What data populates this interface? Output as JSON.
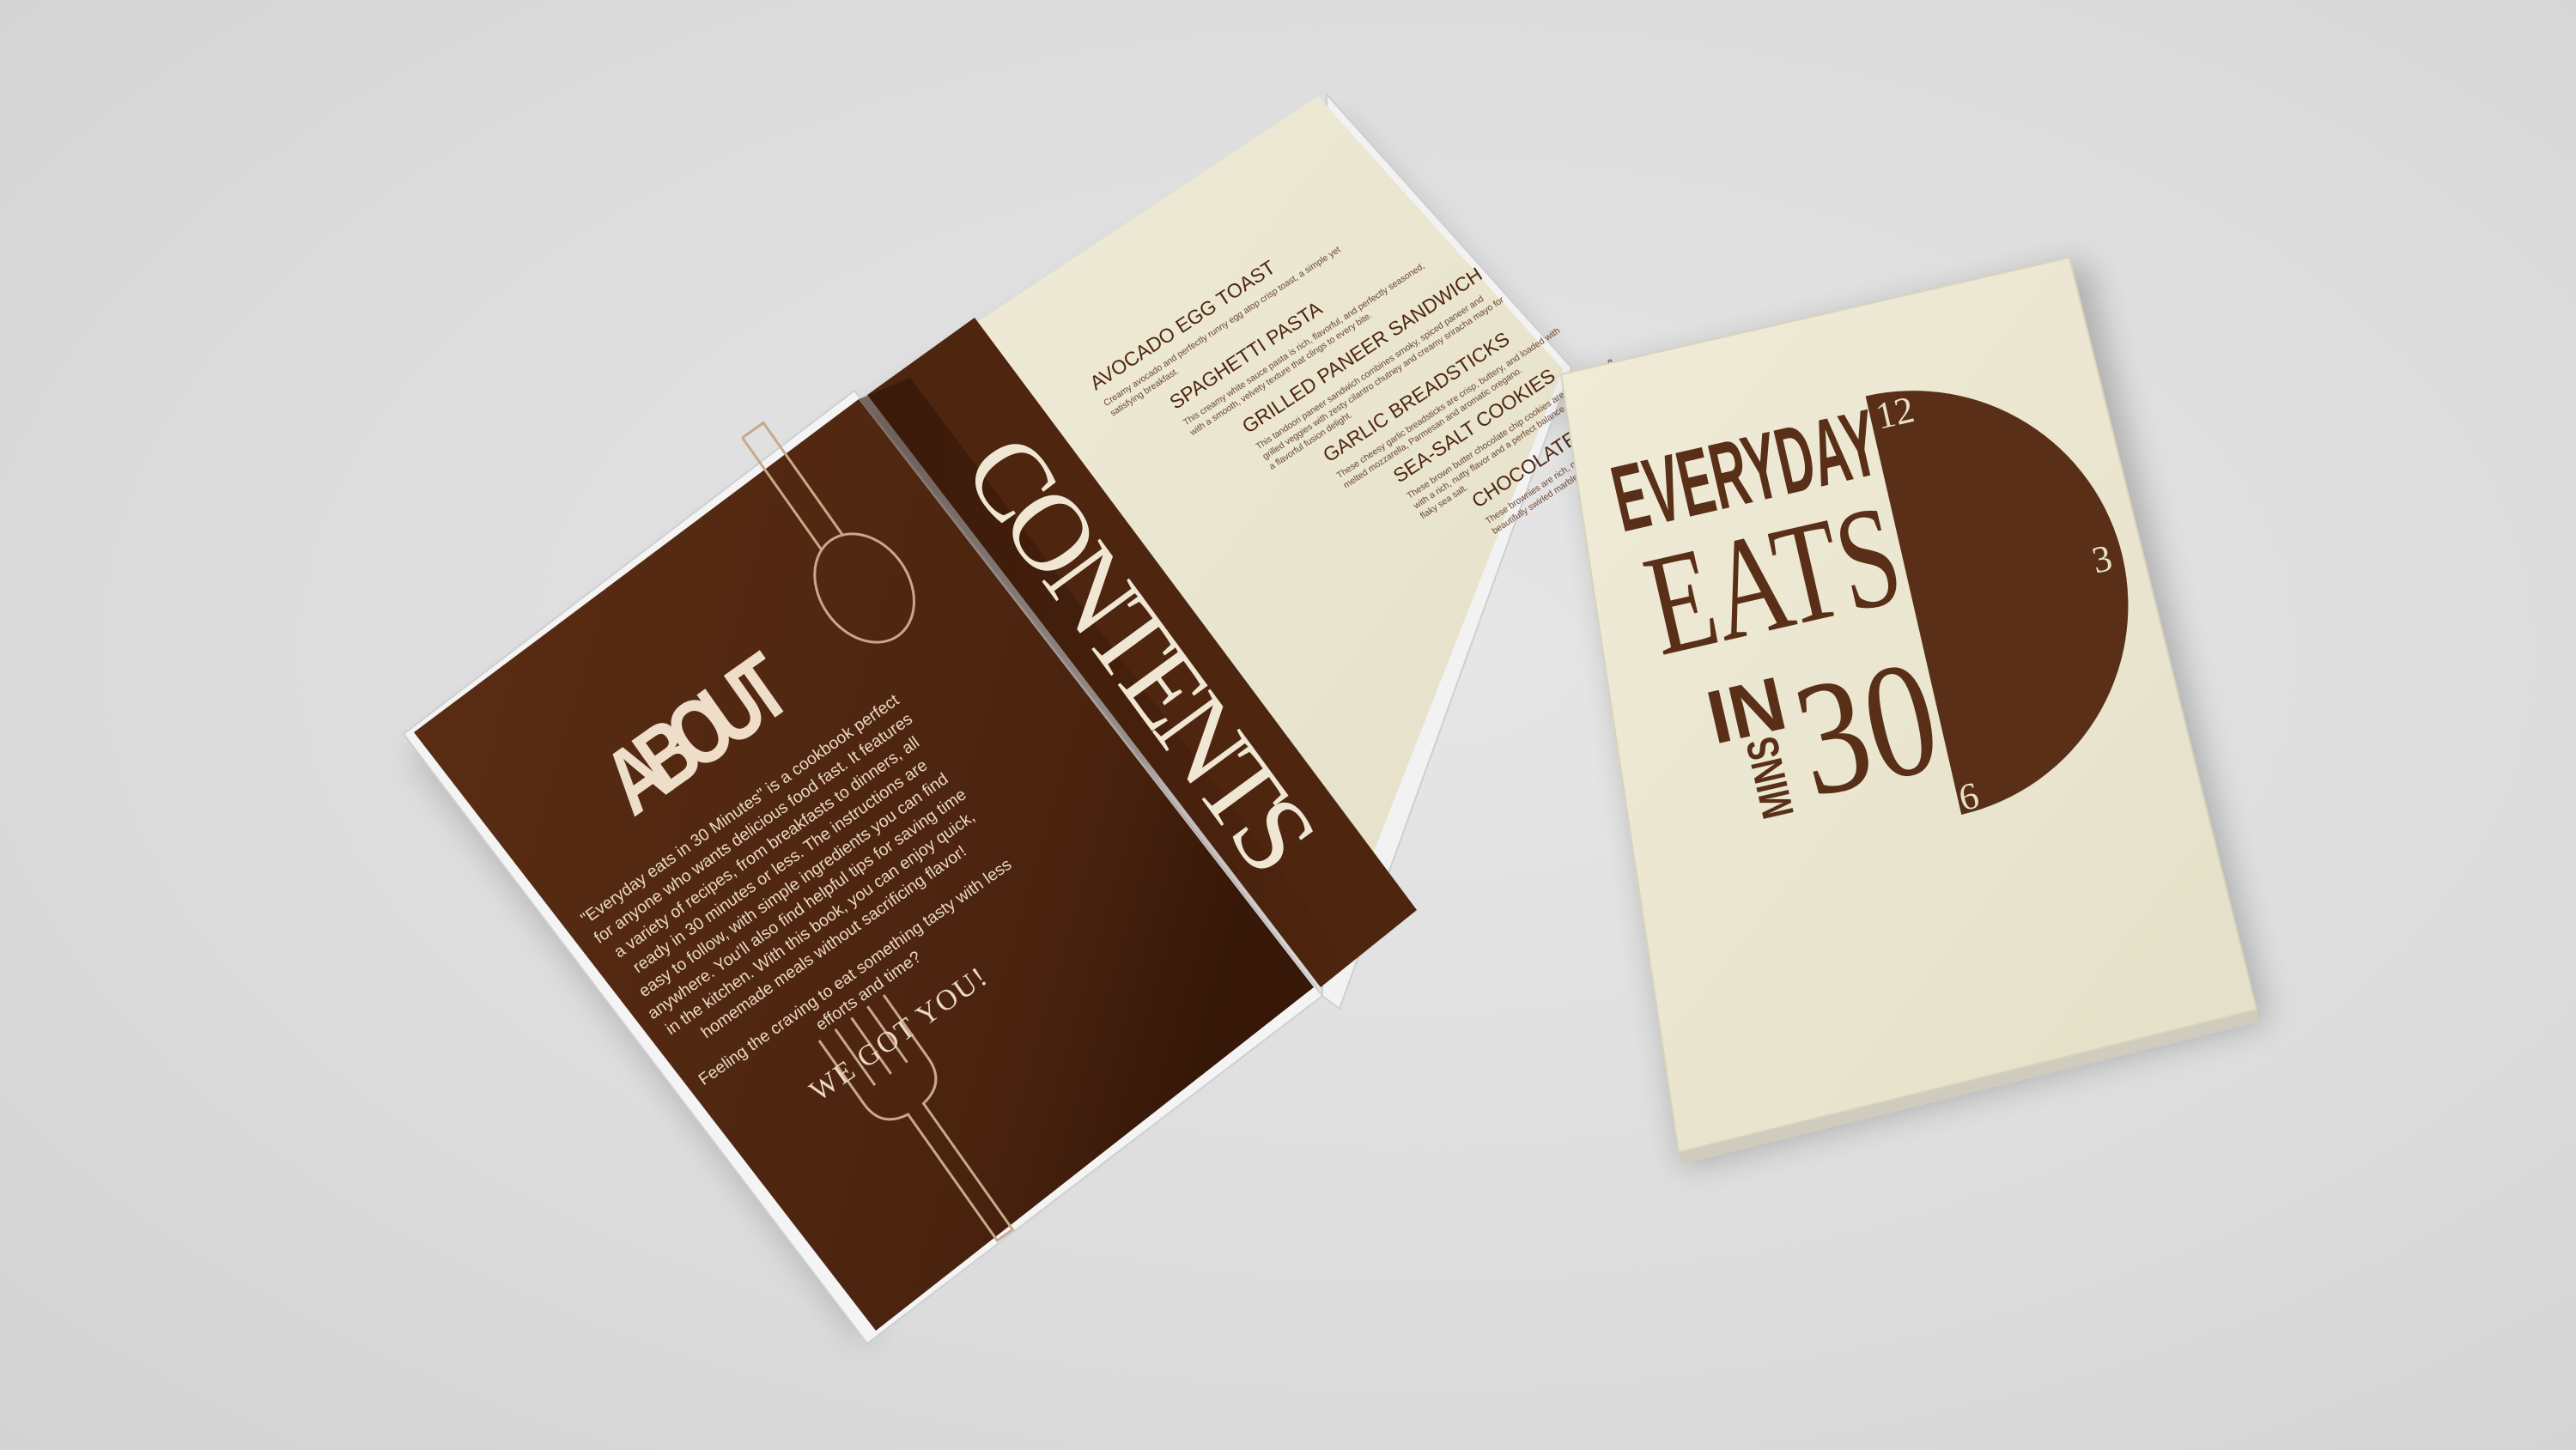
{
  "about_page": {
    "heading": "ABOUT",
    "body_lines": [
      "\"Everyday eats in 30 Minutes\" is a cookbook perfect",
      "for anyone who wants delicious food fast. It features",
      "a variety of recipes, from breakfasts to dinners, all",
      "ready in 30 minutes or less. The instructions are",
      "easy to follow, with simple ingredients you can find",
      "anywhere. You'll also find helpful tips for saving time",
      "in the kitchen. With this book, you can enjoy quick,",
      "homemade meals without sacrificing flavor!"
    ],
    "closing_lines": [
      "Feeling the craving to eat something tasty with less",
      "efforts and time?"
    ],
    "tagline": "WE GOT YOU!"
  },
  "contents_page": {
    "heading": "CONTENTS",
    "items": [
      {
        "title": "AVOCADO EGG TOAST",
        "desc": [
          "Creamy avocado and perfectly runny egg atop crisp toast, a simple yet",
          "satisfying breakfast."
        ]
      },
      {
        "title": "SPAGHETTI PASTA",
        "desc": [
          "This creamy white sauce pasta is rich, flavorful, and perfectly seasoned,",
          "with a smooth, velvety texture that clings to every bite."
        ]
      },
      {
        "title": "GRILLED PANEER SANDWICH",
        "desc": [
          "This tandoori paneer sandwich combines smoky, spiced paneer and",
          "grilled veggies with zesty cilantro chutney and creamy sriracha mayo for",
          "a flavorful fusion delight."
        ]
      },
      {
        "title": "GARLIC BREADSTICKS",
        "desc": [
          "These cheesy garlic breadsticks are crisp, buttery, and loaded with",
          "melted mozzarella, Parmesan and aromatic oregano."
        ]
      },
      {
        "title": "SEA-SALT COOKIES",
        "desc": [
          "These brown butter chocolate chip cookies are irresistibly soft",
          "with a rich, nutty flavor and a perfect balance of sweet and",
          "flaky sea salt."
        ]
      },
      {
        "title": "CHOCOLATE BROWNIES",
        "desc": [
          "These brownies are rich, moist, and indulgent",
          "beautifully swirled marble finish."
        ]
      }
    ]
  },
  "cover": {
    "line1": "EVERYDAY",
    "line2": "EATS",
    "line3_in": "IN",
    "line3_number": "30",
    "line3_unit": "MINS",
    "clock_12": "12",
    "clock_3": "3",
    "clock_6": "6"
  },
  "colors": {
    "brown": "#5a2f18",
    "cream": "#ebe7d3"
  }
}
